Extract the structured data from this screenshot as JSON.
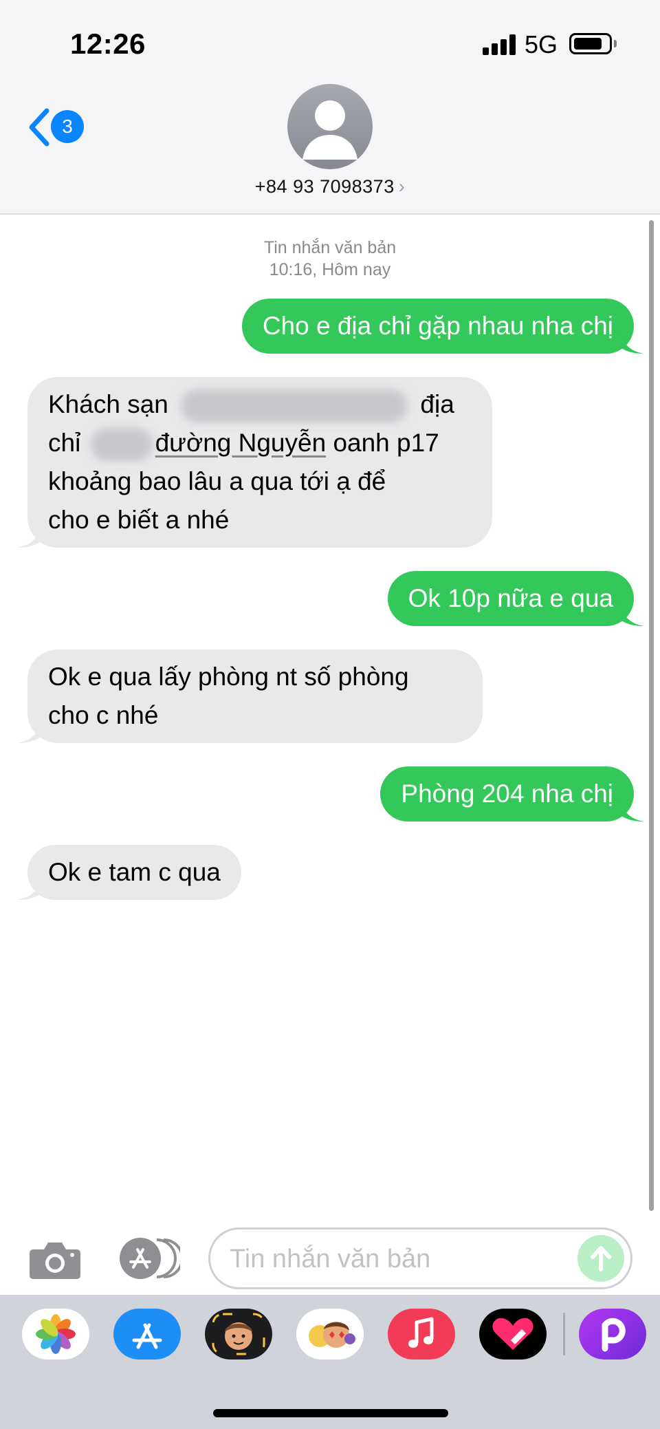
{
  "status_bar": {
    "time": "12:26",
    "network": "5G"
  },
  "header": {
    "back_badge": "3",
    "contact_number": "+84 93 7098373",
    "contact_chevron": "›"
  },
  "conversation": {
    "service_label": "Tin nhắn văn bản",
    "timestamp": "10:16, Hôm nay",
    "messages": [
      {
        "direction": "outgoing",
        "text": "Cho e địa chỉ gặp nhau nha chị"
      },
      {
        "direction": "incoming",
        "line1_start": "Khách sạn",
        "line1_end": "địa",
        "line2_start": "chỉ",
        "line2_link": "đường Nguyễn",
        "line2_end": " oanh p17",
        "line3": "khoảng bao lâu a qua tới ạ để",
        "line4": "cho e biết a nhé"
      },
      {
        "direction": "outgoing",
        "text": "Ok 10p nữa e qua"
      },
      {
        "direction": "incoming",
        "line1": "Ok e qua lấy phòng nt số phòng",
        "line2": "cho c nhé"
      },
      {
        "direction": "outgoing",
        "text": "Phòng 204 nha chị"
      },
      {
        "direction": "incoming",
        "text": "Ok e tam c qua"
      }
    ]
  },
  "input": {
    "placeholder": "Tin nhắn văn bản"
  },
  "colors": {
    "outgoing": "#34c759",
    "incoming": "#e9e9eb",
    "accent": "#0a84ff"
  },
  "app_drawer": {
    "apps": [
      "photos-app-icon",
      "app-store-icon",
      "memoji-icon",
      "animoji-stickers-icon",
      "music-icon",
      "fitness-heart-icon",
      "picsart-icon"
    ]
  }
}
